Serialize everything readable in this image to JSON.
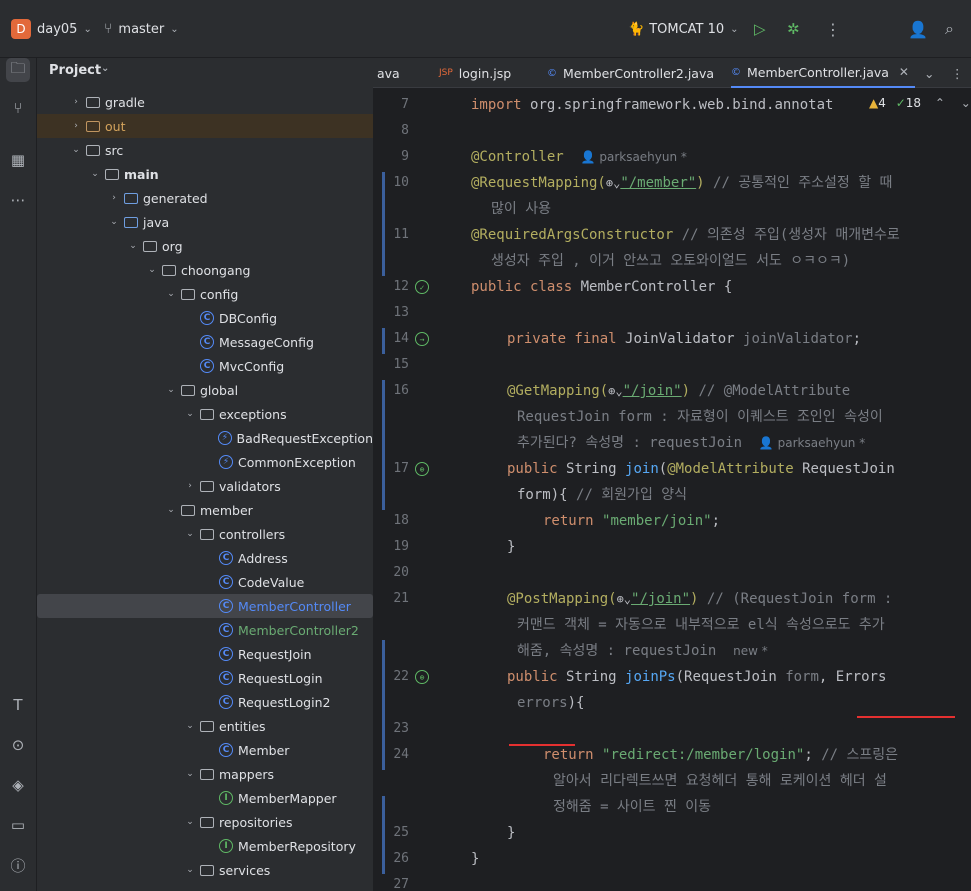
{
  "topbar": {
    "project_badge": "D",
    "project_name": "day05",
    "branch": "master",
    "run_config": "TOMCAT 10"
  },
  "project_panel": {
    "title": "Project",
    "tree": [
      {
        "label": "gradle",
        "type": "folder",
        "depth": 0,
        "expanded": false
      },
      {
        "label": "out",
        "type": "folder-out",
        "depth": 0,
        "expanded": false
      },
      {
        "label": "src",
        "type": "folder",
        "depth": 0,
        "expanded": true
      },
      {
        "label": "main",
        "type": "folder",
        "depth": 1,
        "expanded": true
      },
      {
        "label": "generated",
        "type": "folder-blue",
        "depth": 2
      },
      {
        "label": "java",
        "type": "folder-blue",
        "depth": 2,
        "expanded": true
      },
      {
        "label": "org",
        "type": "package",
        "depth": 3,
        "expanded": true
      },
      {
        "label": "choongang",
        "type": "package",
        "depth": 4,
        "expanded": true
      },
      {
        "label": "config",
        "type": "package",
        "depth": 5,
        "expanded": true
      },
      {
        "label": "DBConfig",
        "type": "class",
        "depth": 6
      },
      {
        "label": "MessageConfig",
        "type": "class",
        "depth": 6
      },
      {
        "label": "MvcConfig",
        "type": "class",
        "depth": 6
      },
      {
        "label": "global",
        "type": "package",
        "depth": 5,
        "expanded": true
      },
      {
        "label": "exceptions",
        "type": "package",
        "depth": 6,
        "expanded": true
      },
      {
        "label": "BadRequestException",
        "type": "exception",
        "depth": 7
      },
      {
        "label": "CommonException",
        "type": "exception",
        "depth": 7
      },
      {
        "label": "validators",
        "type": "package",
        "depth": 6,
        "expanded": false
      },
      {
        "label": "member",
        "type": "package",
        "depth": 5,
        "expanded": true
      },
      {
        "label": "controllers",
        "type": "package",
        "depth": 6,
        "expanded": true
      },
      {
        "label": "Address",
        "type": "class",
        "depth": 7
      },
      {
        "label": "CodeValue",
        "type": "class",
        "depth": 7
      },
      {
        "label": "MemberController",
        "type": "class",
        "depth": 7,
        "selected": true
      },
      {
        "label": "MemberController2",
        "type": "class",
        "depth": 7,
        "green": true
      },
      {
        "label": "RequestJoin",
        "type": "class",
        "depth": 7
      },
      {
        "label": "RequestLogin",
        "type": "class",
        "depth": 7
      },
      {
        "label": "RequestLogin2",
        "type": "class",
        "depth": 7
      },
      {
        "label": "entities",
        "type": "package",
        "depth": 6,
        "expanded": true
      },
      {
        "label": "Member",
        "type": "class",
        "depth": 7
      },
      {
        "label": "mappers",
        "type": "package",
        "depth": 6,
        "expanded": true
      },
      {
        "label": "MemberMapper",
        "type": "interface",
        "depth": 7
      },
      {
        "label": "repositories",
        "type": "package",
        "depth": 6,
        "expanded": true
      },
      {
        "label": "MemberRepository",
        "type": "interface",
        "depth": 7
      },
      {
        "label": "services",
        "type": "package",
        "depth": 6,
        "expanded": true
      }
    ]
  },
  "tabs": [
    {
      "label": "ava",
      "icon": "none"
    },
    {
      "label": "login.jsp",
      "icon": "jsp"
    },
    {
      "label": "MemberController2.java",
      "icon": "class"
    },
    {
      "label": "MemberController.java",
      "icon": "class",
      "active": true
    }
  ],
  "inspection": {
    "warnings": "4",
    "ok": "18"
  },
  "code": {
    "lines": {
      "n7": "7",
      "n8": "8",
      "n9": "9",
      "n10": "10",
      "n11": "11",
      "n12": "12",
      "n13": "13",
      "n14": "14",
      "n15": "15",
      "n16": "16",
      "n17": "17",
      "n18": "18",
      "n19": "19",
      "n20": "20",
      "n21": "21",
      "n22": "22",
      "n23": "23",
      "n24": "24",
      "n25": "25",
      "n26": "26",
      "n27": "27"
    },
    "import_kw": "import",
    "import_rest": "org.springframework.web.bind.annotat",
    "controller_ann": "@Controller",
    "author_hint": "parksaehyun *",
    "reqmap_ann": "@RequestMapping(",
    "reqmap_path": "\"/member\"",
    "reqmap_close": ")",
    "reqmap_comment": "// 공통적인 주소설정 할 때",
    "reqmap_comment2": "많이 사용",
    "rac_ann": "@RequiredArgsConstructor",
    "rac_comment": "// 의존성 주입(생성자 매개변수로",
    "rac_comment2": "생성자 주입 , 이거 안쓰고 오토와이얼드 서도 ㅇㅋㅇㅋ)",
    "class_kw": "public class",
    "class_name": "MemberController {",
    "field_kw": "private final",
    "field_type": "JoinValidator",
    "field_name": "joinValidator",
    "field_end": ";",
    "getmap_ann": "@GetMapping(",
    "getmap_path": "\"/join\"",
    "getmap_close": ")",
    "getmap_comment": "// @ModelAttribute",
    "getmap_comment2": "RequestJoin form : 자료형이 이퀘스트 조인인 속성이",
    "getmap_comment3": "추가된다? 속성명 : requestJoin",
    "author_hint2": "parksaehyun *",
    "join_kw": "public",
    "join_type": "String",
    "join_fn": "join",
    "join_ann": "@ModelAttribute",
    "join_param": "RequestJoin",
    "join_line2": "form){",
    "join_comment": "// 회원가입 양식",
    "return_kw": "return",
    "return_str": "\"member/join\"",
    "return_end": ";",
    "brace_close": "}",
    "postmap_ann": "@PostMapping(",
    "postmap_path": "\"/join\"",
    "postmap_close": ")",
    "postmap_comment": "// (RequestJoin form :",
    "postmap_comment2": "커맨드 객체 = 자동으로 내부적으로 el식 속성으로도 추가",
    "postmap_comment3": "해줌, 속성명 : requestJoin",
    "new_hint": "new *",
    "joinps_kw": "public",
    "joinps_type": "String",
    "joinps_fn": "joinPs",
    "joinps_params": "(RequestJoin",
    "joinps_form": "form",
    "joinps_comma": ",",
    "joinps_errors_type": "Errors",
    "joinps_errors": "errors",
    "joinps_end": "){",
    "redirect_kw": "return",
    "redirect_str": "\"redirect:/member/login\"",
    "redirect_end": ";",
    "redirect_comment": "// 스프링은",
    "redirect_comment2": "알아서 리다렉트쓰면 요청헤더 통해 로케이션 헤더 설",
    "redirect_comment3": "정해줌 = 사이트 찐 이동",
    "inner_close": "}",
    "class_close": "}"
  },
  "colors": {
    "accent": "#548af7",
    "annotation_underline": "#e53030"
  }
}
